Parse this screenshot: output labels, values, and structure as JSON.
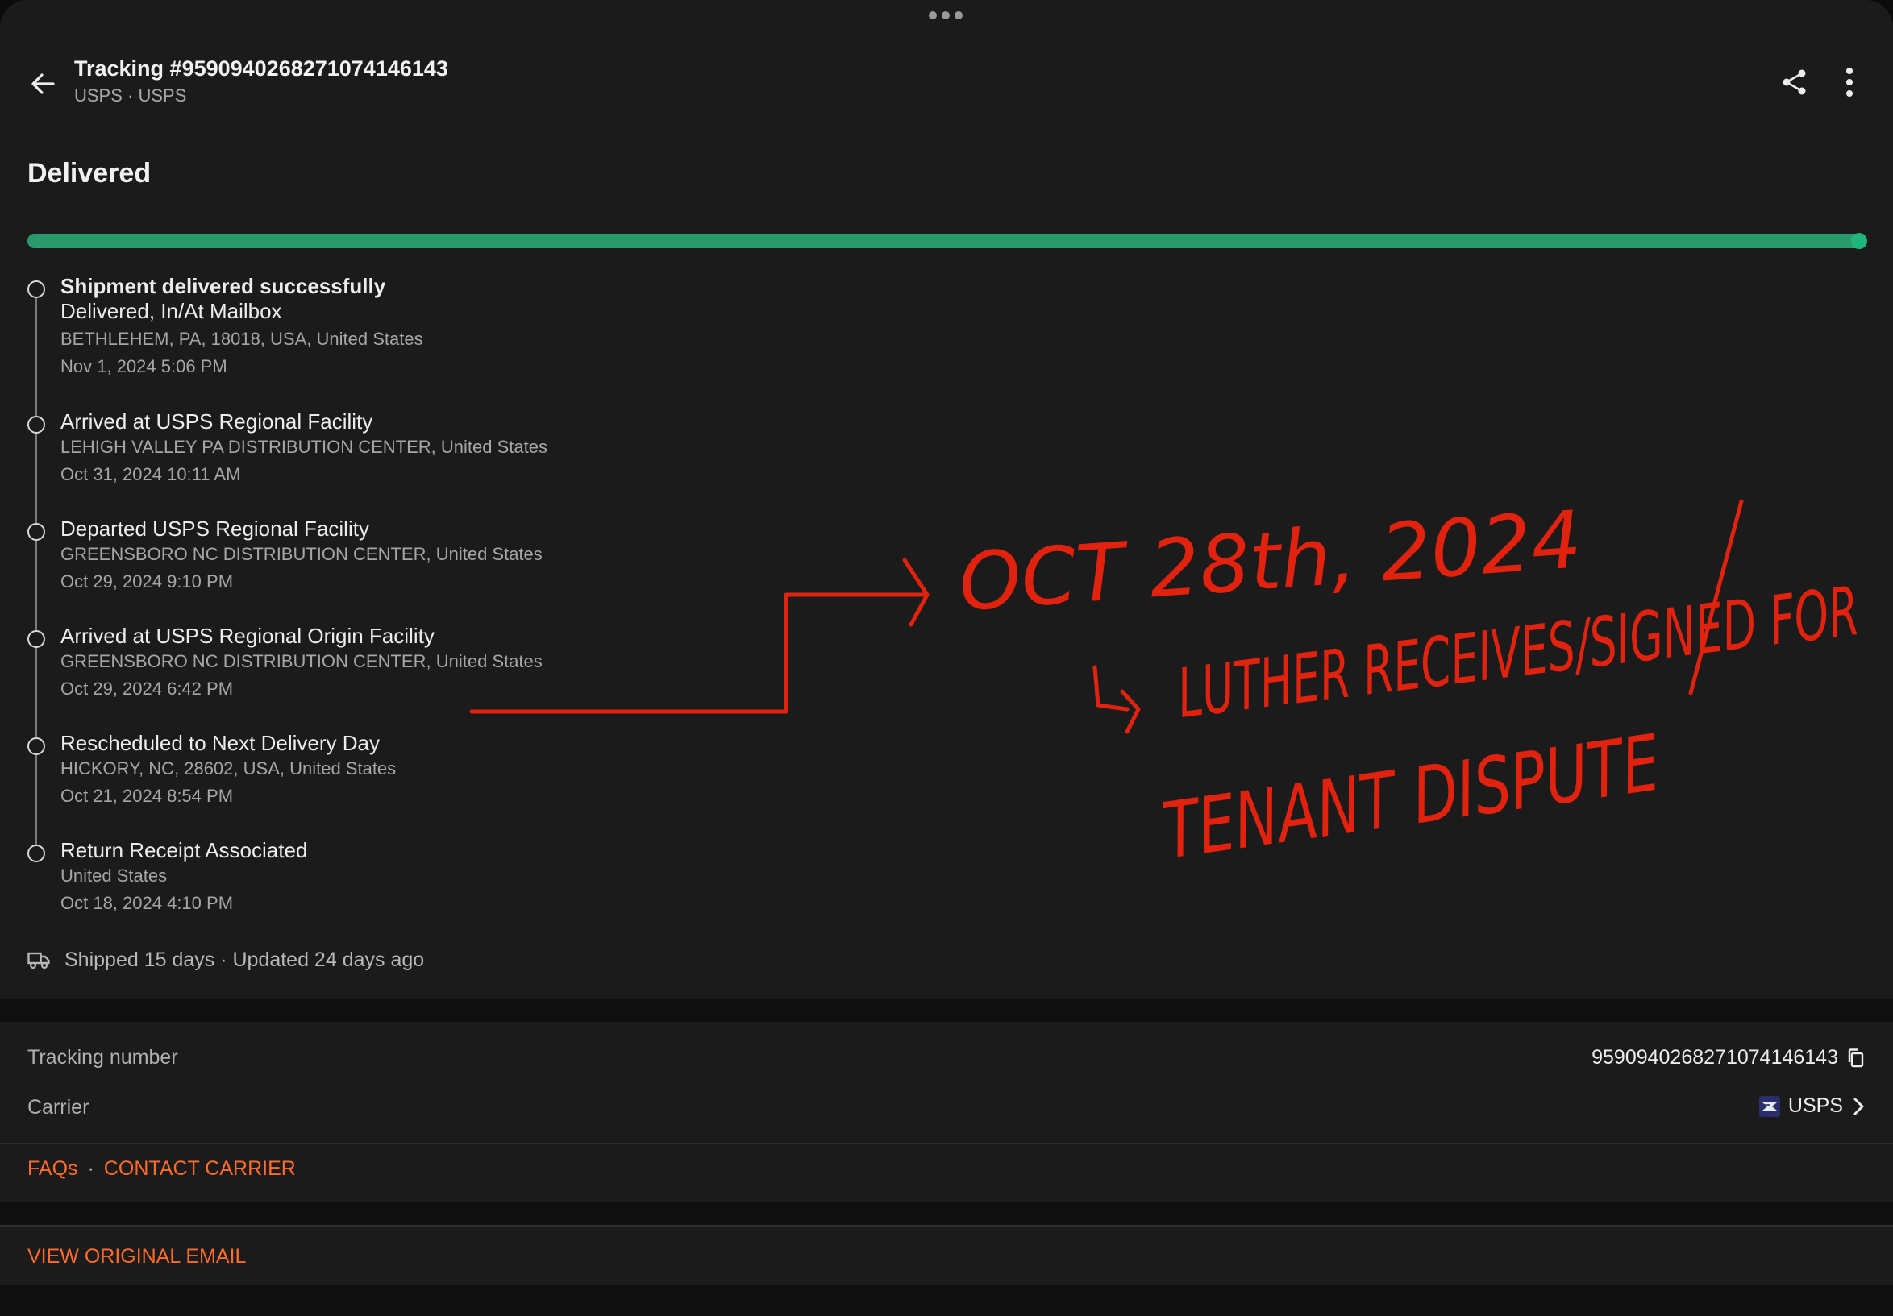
{
  "header": {
    "title": "Tracking #9590940268271074146143",
    "subtitle": "USPS · USPS"
  },
  "status": {
    "label": "Delivered",
    "progress": 1.0,
    "color": "#2a9a6d"
  },
  "events": [
    {
      "title": "Shipment delivered successfully",
      "subtitle": "Delivered, In/At Mailbox",
      "location": "BETHLEHEM, PA, 18018, USA, United States",
      "time": "Nov 1, 2024  5:06 PM"
    },
    {
      "title": "Arrived at USPS Regional Facility",
      "location": "LEHIGH VALLEY PA DISTRIBUTION CENTER, United States",
      "time": "Oct 31, 2024  10:11 AM"
    },
    {
      "title": "Departed USPS Regional Facility",
      "location": "GREENSBORO NC DISTRIBUTION CENTER, United States",
      "time": "Oct 29, 2024  9:10 PM"
    },
    {
      "title": "Arrived at USPS Regional Origin Facility",
      "location": "GREENSBORO NC DISTRIBUTION CENTER, United States",
      "time": "Oct 29, 2024  6:42 PM"
    },
    {
      "title": "Rescheduled to Next Delivery Day",
      "location": "HICKORY, NC, 28602, USA, United States",
      "time": "Oct 21, 2024  8:54 PM"
    },
    {
      "title": "Return Receipt Associated",
      "location": "United States",
      "time": "Oct 18, 2024  4:10 PM"
    }
  ],
  "summary": {
    "text": "Shipped 15 days · Updated 24 days ago"
  },
  "details": {
    "tracking_label": "Tracking number",
    "tracking_value": "9590940268271074146143",
    "carrier_label": "Carrier",
    "carrier_value": "USPS"
  },
  "links": {
    "faqs": "FAQs",
    "separator": "·",
    "contact": "CONTACT CARRIER",
    "view_email": "VIEW ORIGINAL EMAIL"
  },
  "annotation": {
    "line1": "OCT 28th, 2024",
    "line2": "LUTHER RECEIVES/SIGNED FOR",
    "line3": "TENANT DISPUTE",
    "color": "#e0220f"
  },
  "icons": {
    "back": "back-arrow-icon",
    "share": "share-icon",
    "more": "more-vertical-icon",
    "truck": "truck-icon",
    "copy": "copy-icon",
    "chevron": "chevron-right-icon",
    "usps": "usps-logo-icon"
  }
}
